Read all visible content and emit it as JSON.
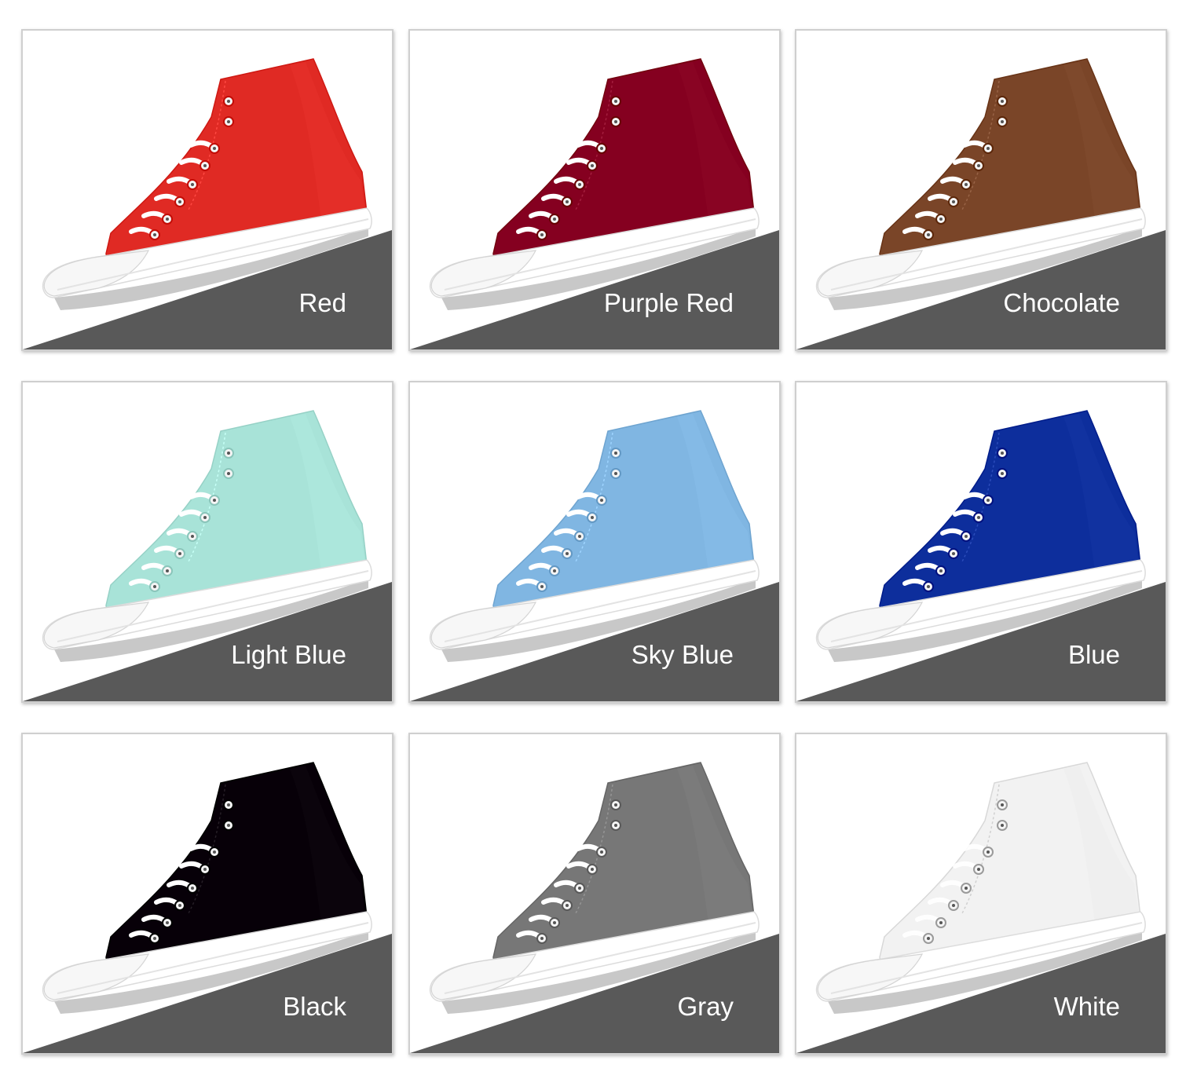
{
  "swatches": [
    {
      "label": "Red",
      "color": "#e02a24"
    },
    {
      "label": "Purple Red",
      "color": "#850020"
    },
    {
      "label": "Chocolate",
      "color": "#7a4528"
    },
    {
      "label": "Light Blue",
      "color": "#a8e3d8"
    },
    {
      "label": "Sky Blue",
      "color": "#80b6e2"
    },
    {
      "label": "Blue",
      "color": "#0d2e9c"
    },
    {
      "label": "Black",
      "color": "#070008"
    },
    {
      "label": "Gray",
      "color": "#777777"
    },
    {
      "label": "White",
      "color": "#f2f2f2"
    }
  ],
  "colors": {
    "floor": "#595959",
    "sole": "#ffffff",
    "lace": "#ffffff",
    "border": "#cfcfcf"
  },
  "icons": {
    "shoe": "high-top-sneaker-icon"
  }
}
